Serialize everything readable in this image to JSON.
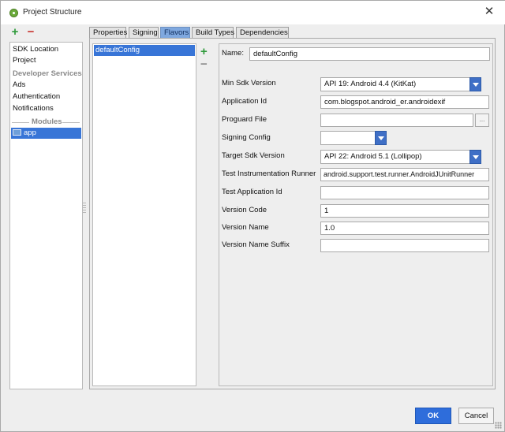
{
  "window": {
    "title": "Project Structure",
    "close_glyph": "✕"
  },
  "left_panel": {
    "add_glyph": "+",
    "remove_glyph": "−",
    "items": [
      {
        "label": "SDK Location"
      },
      {
        "label": "Project"
      },
      {
        "label": "Developer Services"
      },
      {
        "label": "Ads"
      },
      {
        "label": "Authentication"
      },
      {
        "label": "Notifications"
      }
    ],
    "modules_header": "Modules",
    "module": "app"
  },
  "tabs": [
    {
      "label": "Properties"
    },
    {
      "label": "Signing"
    },
    {
      "label": "Flavors"
    },
    {
      "label": "Build Types"
    },
    {
      "label": "Dependencies"
    }
  ],
  "active_tab": "Flavors",
  "flavors": {
    "items": [
      "defaultConfig"
    ],
    "add_glyph": "+",
    "remove_glyph": "−"
  },
  "form": {
    "name": {
      "label": "Name:",
      "value": "defaultConfig"
    },
    "min_sdk": {
      "label": "Min Sdk Version",
      "value": "API 19: Android 4.4 (KitKat)"
    },
    "application_id": {
      "label": "Application Id",
      "value": "com.blogspot.android_er.androidexif"
    },
    "proguard_file": {
      "label": "Proguard File",
      "value": "",
      "browse_glyph": "..."
    },
    "signing_config": {
      "label": "Signing Config",
      "value": ""
    },
    "target_sdk": {
      "label": "Target Sdk Version",
      "value": "API 22: Android 5.1 (Lollipop)"
    },
    "test_runner": {
      "label": "Test Instrumentation Runner",
      "value": "android.support.test.runner.AndroidJUnitRunner"
    },
    "test_app_id": {
      "label": "Test Application Id",
      "value": ""
    },
    "version_code": {
      "label": "Version Code",
      "value": "1"
    },
    "version_name": {
      "label": "Version Name",
      "value": "1.0"
    },
    "version_name_suffix": {
      "label": "Version Name Suffix",
      "value": ""
    }
  },
  "buttons": {
    "ok": "OK",
    "cancel": "Cancel"
  },
  "colors": {
    "accent": "#3875d7",
    "ok_button": "#2e6ddb",
    "add": "#2e9a3a",
    "remove": "#c8352f"
  }
}
